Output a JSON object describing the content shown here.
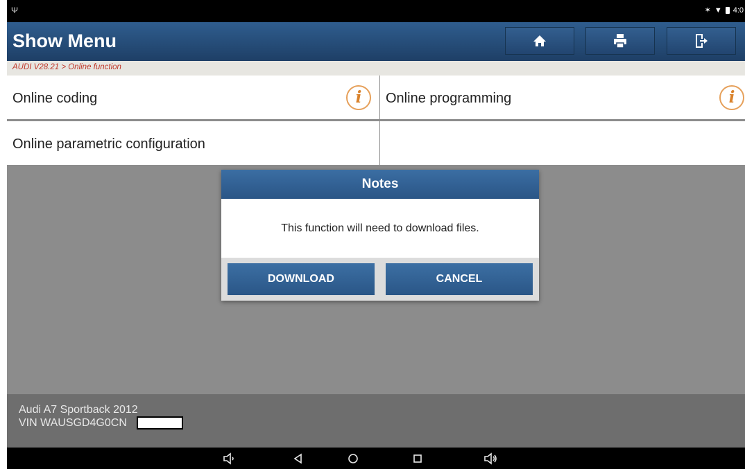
{
  "header": {
    "title": "Show Menu",
    "buttons": [
      {
        "name": "home-button",
        "icon": "home-icon"
      },
      {
        "name": "print-button",
        "icon": "printer-icon"
      },
      {
        "name": "exit-button",
        "icon": "exit-icon"
      }
    ]
  },
  "status": {
    "time": "4:0",
    "icons": [
      "usb-icon",
      "bluetooth-icon",
      "wifi-icon",
      "battery-icon"
    ]
  },
  "breadcrumb": "AUDI V28.21 > Online function",
  "menu": {
    "items": [
      {
        "label": "Online coding"
      },
      {
        "label": "Online programming"
      },
      {
        "label": "Online parametric configuration"
      }
    ]
  },
  "dialog": {
    "title": "Notes",
    "message": "This function will need to download files.",
    "download_label": "DOWNLOAD",
    "cancel_label": "CANCEL"
  },
  "footer": {
    "vehicle": "Audi A7 Sportback 2012",
    "vin": "VIN WAUSGD4G0CN"
  },
  "colors": {
    "header": "#2a5586",
    "breadcrumb_text": "#c0392b",
    "info_icon": "#d9822b"
  }
}
